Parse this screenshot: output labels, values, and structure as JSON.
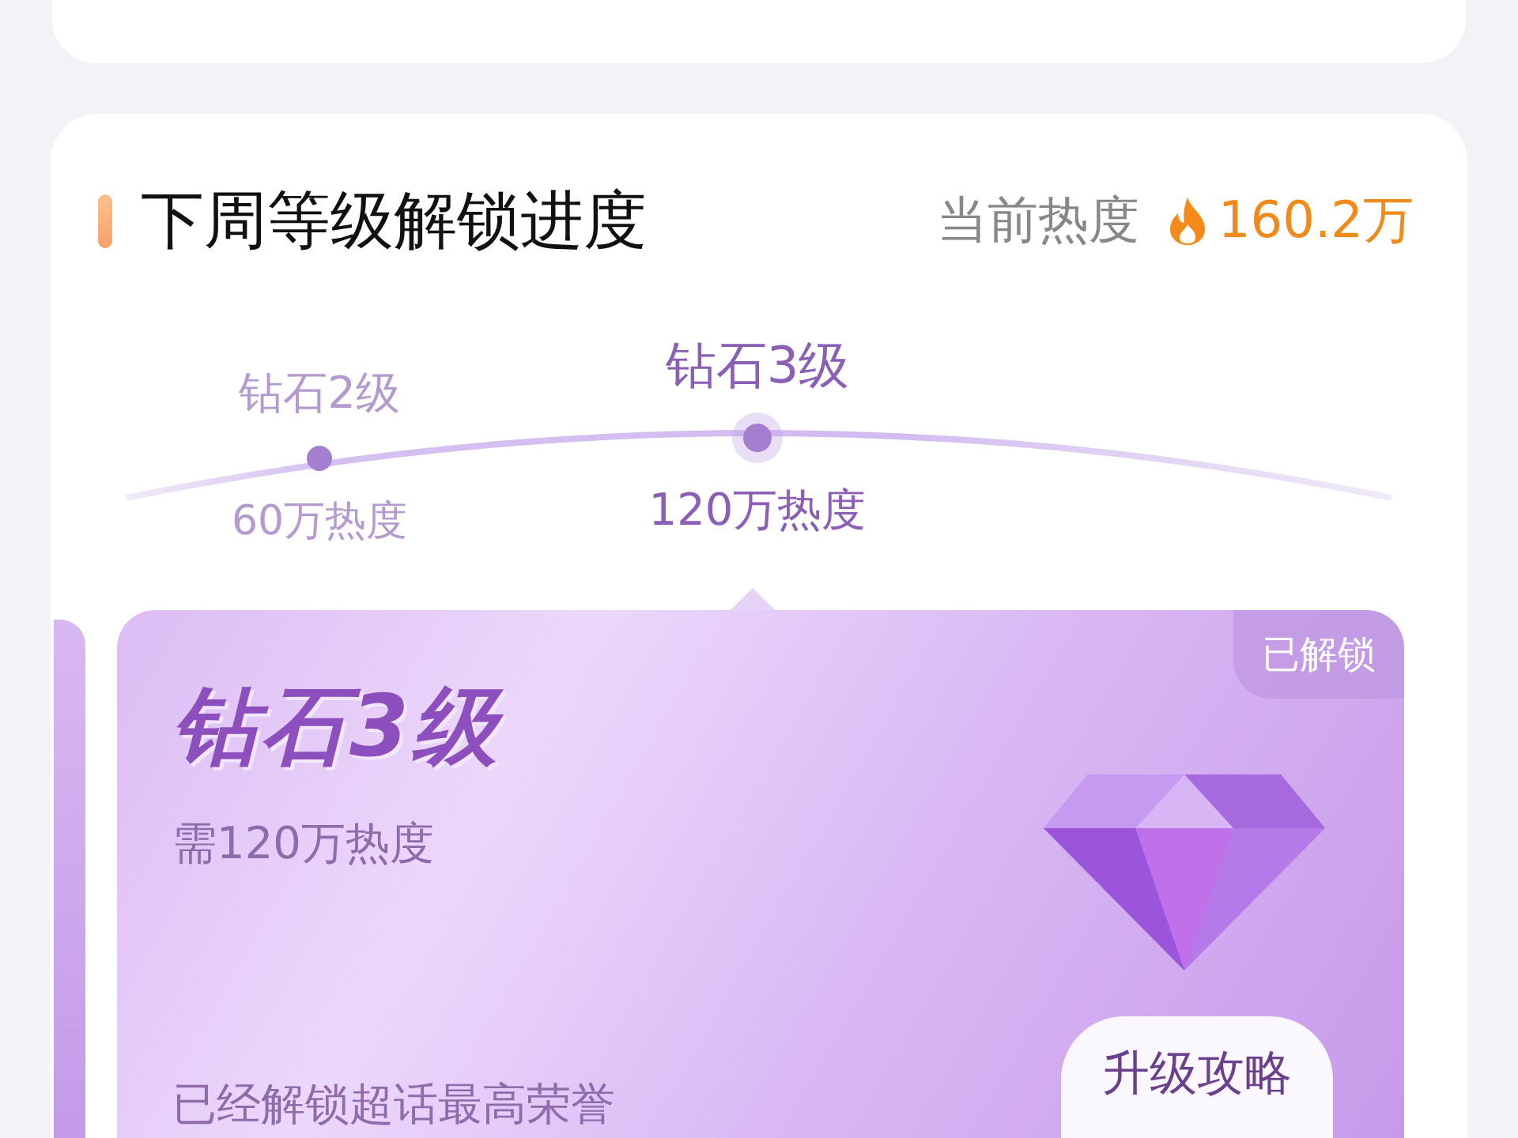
{
  "header": {
    "title": "下周等级解锁进度",
    "heat_label": "当前热度",
    "heat_value": "160.2万"
  },
  "levels": [
    {
      "name": "钻石2级",
      "requirement": "60万热度",
      "selected": false
    },
    {
      "name": "钻石3级",
      "requirement": "120万热度",
      "selected": true
    }
  ],
  "card": {
    "title": "钻石3级",
    "requirement": "需120万热度",
    "badge": "已解锁",
    "description": "已经解锁超话最高荣誉",
    "button": "升级攻略"
  }
}
